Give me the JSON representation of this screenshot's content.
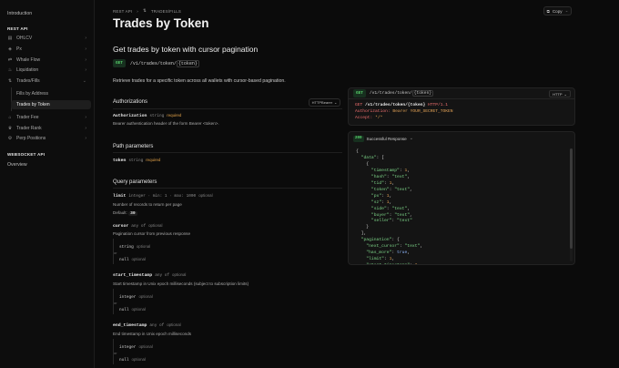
{
  "sidebar": {
    "intro": "Introduction",
    "rest_api_heading": "REST API",
    "items": [
      {
        "label": "OHLCV",
        "icon": "chart-icon"
      },
      {
        "label": "Px",
        "icon": "price-icon"
      },
      {
        "label": "Whale Flow",
        "icon": "whale-icon"
      },
      {
        "label": "Liquidation",
        "icon": "flame-icon"
      },
      {
        "label": "Trades/Fills",
        "icon": "trades-icon"
      }
    ],
    "sub_items": [
      {
        "label": "Fills by Address"
      },
      {
        "label": "Trades by Token"
      }
    ],
    "items2": [
      {
        "label": "Trader Fee",
        "icon": "fee-icon"
      },
      {
        "label": "Trader Rank",
        "icon": "trophy-icon"
      },
      {
        "label": "Perp Positions",
        "icon": "positions-icon"
      }
    ],
    "ws_heading": "WEBSOCKET API",
    "ws_overview": "Overview"
  },
  "breadcrumb": {
    "root": "REST API",
    "sep": "›",
    "current": "TRADES/FILLS"
  },
  "copy_label": "Copy",
  "page_title": "Trades by Token",
  "subtitle": "Get trades by token with cursor pagination",
  "endpoint": {
    "method": "GET",
    "path_prefix": "/v1/trades/token/",
    "path_param": "{token}"
  },
  "description": "Retrieve trades for a specific token across all wallets with cursor-based pagination.",
  "authorizations": {
    "title": "Authorizations",
    "select": "HTTPBearer",
    "field_name": "Authorization",
    "field_type": "string",
    "required_label": "required",
    "field_desc": "Bearer authentication header of the form Bearer <token>."
  },
  "path_params": {
    "title": "Path parameters",
    "field_name": "token",
    "field_type": "string",
    "required_label": "required"
  },
  "query_params": {
    "title": "Query parameters",
    "limit": {
      "name": "limit",
      "type": "integer · min: 1 · max: 1000",
      "opt": "optional",
      "desc": "Number of records to return per page",
      "default_label": "Default:",
      "default_value": "30"
    },
    "cursor": {
      "name": "cursor",
      "type": "any of",
      "opt": "optional",
      "desc": "Pagination cursor from previous response",
      "t1": "string",
      "t2": "null",
      "o1": "optional",
      "o2": "optional"
    },
    "start_timestamp": {
      "name": "start_timestamp",
      "type": "any of",
      "opt": "optional",
      "desc": "Start timestamp in Unix epoch milliseconds (subject to subscription limits)",
      "t1": "integer",
      "t2": "null",
      "o1": "optional",
      "o2": "optional"
    },
    "end_timestamp": {
      "name": "end_timestamp",
      "type": "any of",
      "opt": "optional",
      "desc": "End timestamp in Unix epoch milliseconds",
      "t1": "integer",
      "t2": "null",
      "o1": "optional",
      "o2": "optional"
    },
    "or_label": "or"
  },
  "request_panel": {
    "method": "GET",
    "path_prefix": "/v1/trades/token/",
    "path_param": "{token}",
    "lang": "HTTP",
    "line1_method": "GET",
    "line1_path": "/v1/trades/token/{token}",
    "line1_proto": "HTTP/1.1",
    "line2_key": "Authorization:",
    "line2_val": "Bearer YOUR_SECRET_TOKEN",
    "line3_key": "Accept:",
    "line3_val": "*/*"
  },
  "response_panel": {
    "status": "200",
    "label": "Successful Response"
  },
  "colors": {
    "accent_green": "#58d16b",
    "required_orange": "#e1a148",
    "background": "#0b0b0b"
  }
}
